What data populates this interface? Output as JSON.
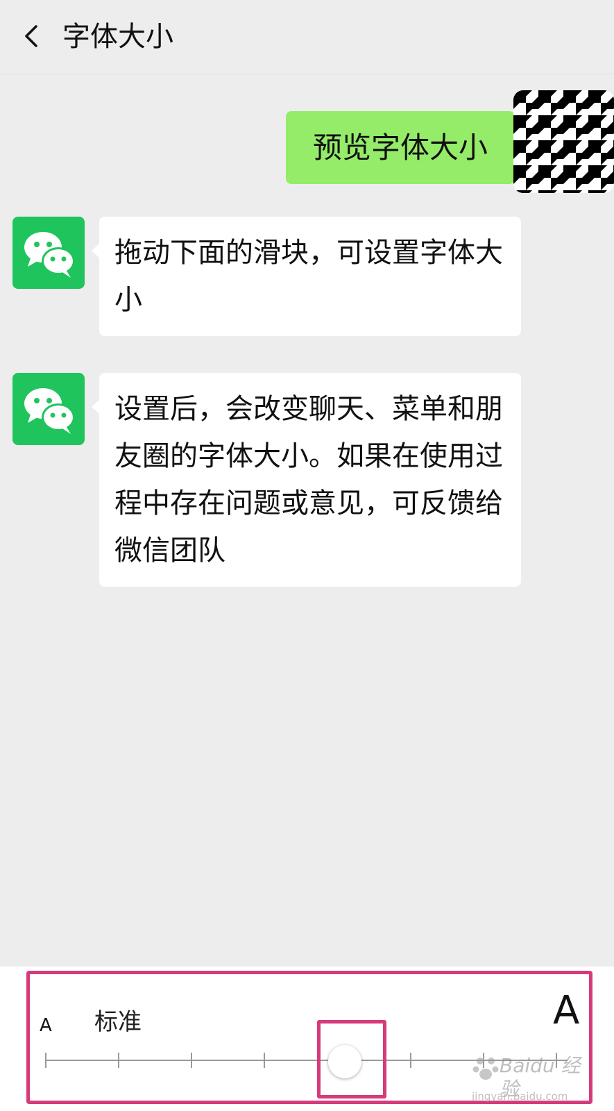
{
  "header": {
    "title": "字体大小"
  },
  "messages": {
    "mine": "预览字体大小",
    "tip1": "拖动下面的滑块，可设置字体大小",
    "tip2": "设置后，会改变聊天、菜单和朋友圈的字体大小。如果在使用过程中存在问题或意见，可反馈给微信团队"
  },
  "font_size": {
    "small_label": "A",
    "large_label": "A",
    "current_label": "标准",
    "positions": 8,
    "selected_index": 4
  },
  "watermark": {
    "brand": "Baidu 经验",
    "url": "jingyan.baidu.com"
  },
  "colors": {
    "accent_green": "#95ec69",
    "wechat_green": "#20c45c",
    "highlight_pink": "#d63a7a",
    "background": "#ededed"
  }
}
